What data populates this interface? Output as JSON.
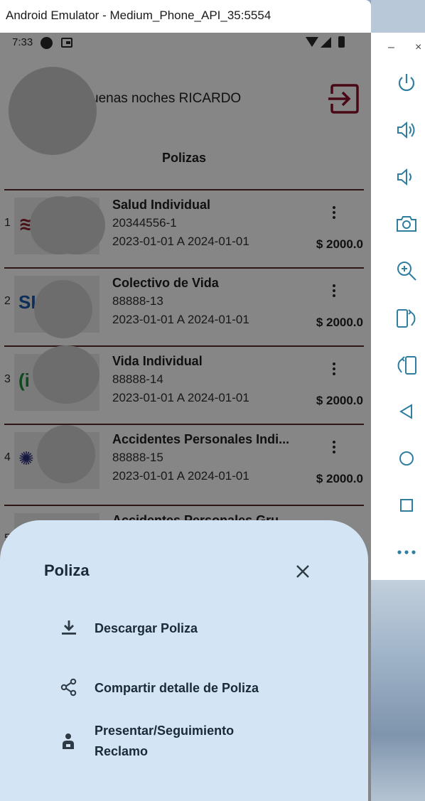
{
  "window": {
    "title": "Android Emulator - Medium_Phone_API_35:5554",
    "minimize_glyph": "–",
    "close_glyph": "×"
  },
  "statusbar": {
    "time": "7:33"
  },
  "header": {
    "greeting": "uenas noches  RICARDO",
    "section_title": "Polizas"
  },
  "policies": [
    {
      "index": "1",
      "name": "Salud Individual",
      "number": "20344556-1",
      "dates": "2023-01-01 A 2024-01-01",
      "amount": "$ 2000.0",
      "logo_text": "≋",
      "logo_color": "#8a1f2a"
    },
    {
      "index": "2",
      "name": "Colectivo de Vida",
      "number": "88888-13",
      "dates": "2023-01-01 A 2024-01-01",
      "amount": "$ 2000.0",
      "logo_text": "SI",
      "logo_color": "#1a57a8"
    },
    {
      "index": "3",
      "name": "Vida Individual",
      "number": "88888-14",
      "dates": "2023-01-01 A 2024-01-01",
      "amount": "$ 2000.0",
      "logo_text": "(i",
      "logo_color": "#1d8a3b"
    },
    {
      "index": "4",
      "name": "Accidentes Personales Indi...",
      "number": "88888-15",
      "dates": "2023-01-01 A 2024-01-01",
      "amount": "$ 2000.0",
      "logo_text": "✺",
      "logo_color": "#2b2f7a"
    },
    {
      "index": "5",
      "name": "Accidentes Personales Gru...",
      "number": "",
      "dates": "",
      "amount": "",
      "logo_text": "",
      "logo_color": "#1d8a3b"
    }
  ],
  "sheet": {
    "title": "Poliza",
    "items": [
      {
        "label": "Descargar Poliza",
        "icon": "download-icon"
      },
      {
        "label": "Compartir detalle de Poliza",
        "icon": "share-icon"
      },
      {
        "label": "Presentar/Seguimiento Reclamo",
        "icon": "claim-person-icon"
      }
    ]
  },
  "colors": {
    "accent": "#8a1029",
    "sheet_bg": "#d3e4f5",
    "text_dark": "#1b2a36"
  }
}
